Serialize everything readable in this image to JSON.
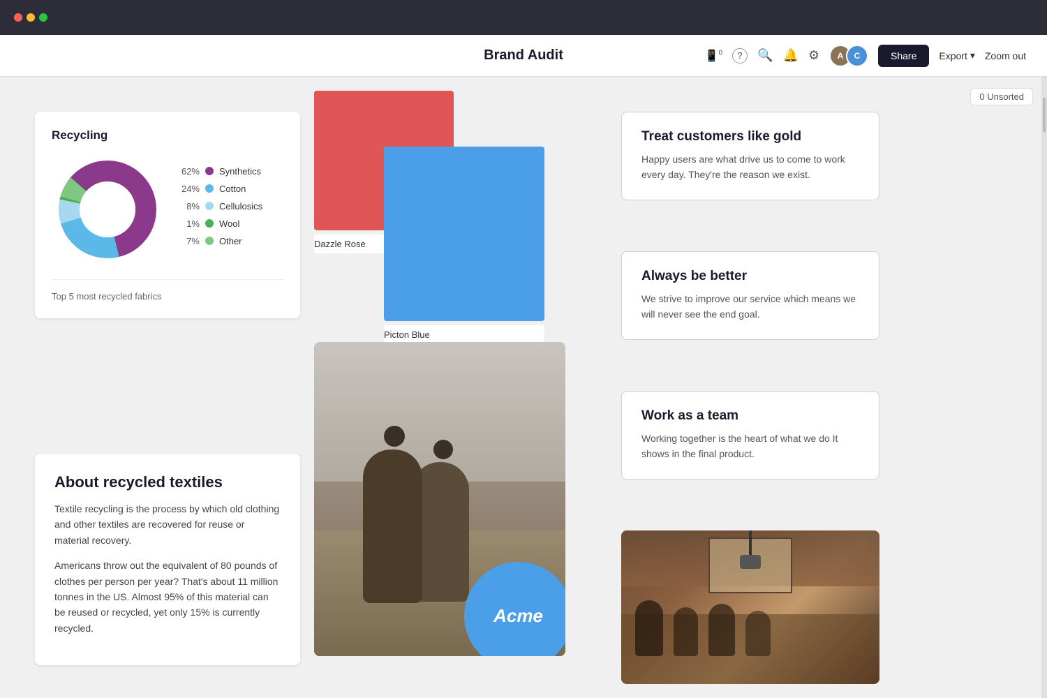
{
  "titlebar": {
    "dots": [
      "red",
      "yellow",
      "green"
    ]
  },
  "header": {
    "title": "Brand Audit",
    "icons": {
      "phone_badge": "0",
      "help": "?",
      "search": "🔍",
      "bell": "🔔",
      "settings": "⚙"
    },
    "share_label": "Share",
    "export_label": "Export",
    "export_chevron": "▾",
    "zoom_label": "Zoom out",
    "avatars": [
      {
        "id": "avatar-1",
        "initial": "A"
      },
      {
        "id": "avatar-2",
        "initial": "C"
      }
    ]
  },
  "canvas": {
    "unsorted_badge": "0 Unsorted"
  },
  "recycling_card": {
    "title": "Recycling",
    "chart": {
      "segments": [
        {
          "label": "Synthetics",
          "pct": 62,
          "color": "#8B3A8B",
          "start": 0,
          "sweep": 223
        },
        {
          "label": "Cotton",
          "pct": 24,
          "color": "#5BB8E8",
          "start": 223,
          "sweep": 86
        },
        {
          "label": "Cellulosics",
          "pct": 8,
          "color": "#A8D8F0",
          "start": 309,
          "sweep": 29
        },
        {
          "label": "Wool",
          "pct": 1,
          "color": "#4CAF50",
          "start": 338,
          "sweep": 4
        },
        {
          "label": "Other",
          "pct": 7,
          "color": "#81C784",
          "start": 342,
          "sweep": 25
        }
      ]
    },
    "legend": [
      {
        "pct": "62%",
        "label": "Synthetics",
        "color": "#8B3A8B"
      },
      {
        "pct": "24%",
        "label": "Cotton",
        "color": "#5BB8E8"
      },
      {
        "pct": "8%",
        "label": "Cellulosics",
        "color": "#A8D8F0"
      },
      {
        "pct": "1%",
        "label": "Wool",
        "color": "#4CAF50"
      },
      {
        "pct": "7%",
        "label": "Other",
        "color": "#81C784"
      }
    ],
    "footer": "Top 5 most recycled fabrics"
  },
  "about_card": {
    "title": "About recycled textiles",
    "paragraphs": [
      "Textile recycling is the process by which old clothing and other textiles are recovered for reuse or material recovery.",
      "Americans throw out the equivalent of 80 pounds of clothes per person per year? That's about 11 million tonnes in the US. Almost 95% of this material can be reused or recycled, yet only 15% is currently recycled."
    ]
  },
  "swatches": [
    {
      "id": "rose",
      "label": "Dazzle Rose",
      "color": "#e05555"
    },
    {
      "id": "blue",
      "label": "Picton Blue",
      "color": "#4a9fe8"
    }
  ],
  "acme_logo": "Acme",
  "value_cards": [
    {
      "title": "Treat customers like gold",
      "text": "Happy users are what drive us to come to work every day. They're the reason we exist."
    },
    {
      "title": "Always be better",
      "text": "We strive to improve our service which means we will never see the end goal."
    },
    {
      "title": "Work as a team",
      "text": "Working together is the heart of what we do It shows in the final product."
    }
  ]
}
